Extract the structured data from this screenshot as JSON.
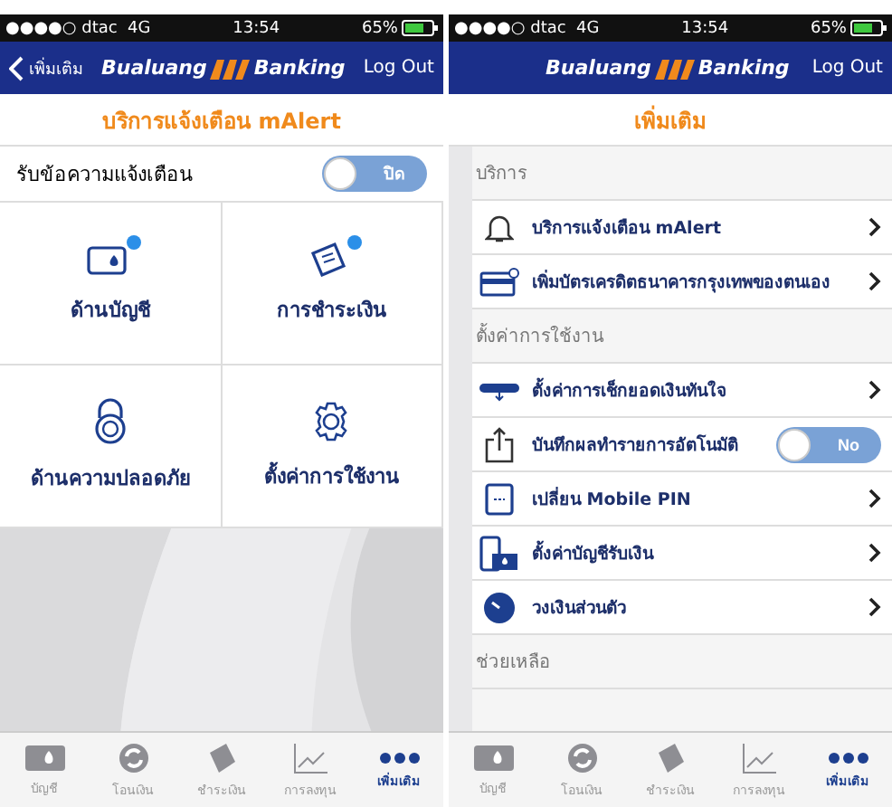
{
  "left_screen": {
    "status_bar": {
      "signal": "●●●●○",
      "carrier": "dtac",
      "network": "4G",
      "time": "13:54",
      "battery": "65%"
    },
    "nav": {
      "back_label": "เพิ่มเติม",
      "logo_left": "Bualuang",
      "logo_right": "Banking",
      "logout": "Log Out"
    },
    "title": "บริการแจ้งเตือน mAlert",
    "setting": {
      "label": "รับข้อความแจ้งเตือน",
      "switch_label": "ปิด",
      "on": false
    },
    "tiles": [
      {
        "label": "ด้านบัญชี",
        "badge": true
      },
      {
        "label": "การชำระเงิน",
        "badge": true
      },
      {
        "label": "ด้านความปลอดภัย",
        "badge": false
      },
      {
        "label": "ตั้งค่าการใช้งาน",
        "badge": false
      }
    ],
    "tab_bar": [
      {
        "label": "บัญชี",
        "selected": false
      },
      {
        "label": "โอนเงิน",
        "selected": false
      },
      {
        "label": "ชำระเงิน",
        "selected": false
      },
      {
        "label": "การลงทุน",
        "selected": false
      },
      {
        "label": "เพิ่มเติม",
        "selected": true
      }
    ]
  },
  "right_screen": {
    "status_bar": {
      "signal": "●●●●○",
      "carrier": "dtac",
      "network": "4G",
      "time": "13:54",
      "battery": "65%"
    },
    "nav": {
      "logo_left": "Bualuang",
      "logo_right": "Banking",
      "logout": "Log Out"
    },
    "title": "เพิ่มเติม",
    "sections": [
      {
        "heading": "บริการ",
        "rows": [
          {
            "kind": "link",
            "label": "บริการแจ้งเตือน mAlert"
          },
          {
            "kind": "link",
            "label": "เพิ่มบัตรเครดิตธนาคารกรุงเทพของตนเอง"
          }
        ]
      },
      {
        "heading": "ตั้งค่าการใช้งาน",
        "rows": [
          {
            "kind": "link",
            "label": "ตั้งค่าการเช็กยอดเงินทันใจ"
          },
          {
            "kind": "toggle",
            "label": "บันทึกผลทำรายการอัตโนมัติ",
            "switch_label": "No",
            "on": false
          },
          {
            "kind": "link",
            "label": "เปลี่ยน Mobile PIN"
          },
          {
            "kind": "link",
            "label": "ตั้งค่าบัญชีรับเงิน"
          },
          {
            "kind": "link",
            "label": "วงเงินส่วนตัว"
          }
        ]
      },
      {
        "heading": "ช่วยเหลือ"
      }
    ],
    "tab_bar": [
      {
        "label": "บัญชี",
        "selected": false
      },
      {
        "label": "โอนเงิน",
        "selected": false
      },
      {
        "label": "ชำระเงิน",
        "selected": false
      },
      {
        "label": "การลงทุน",
        "selected": false
      },
      {
        "label": "เพิ่มเติม",
        "selected": true
      }
    ]
  }
}
